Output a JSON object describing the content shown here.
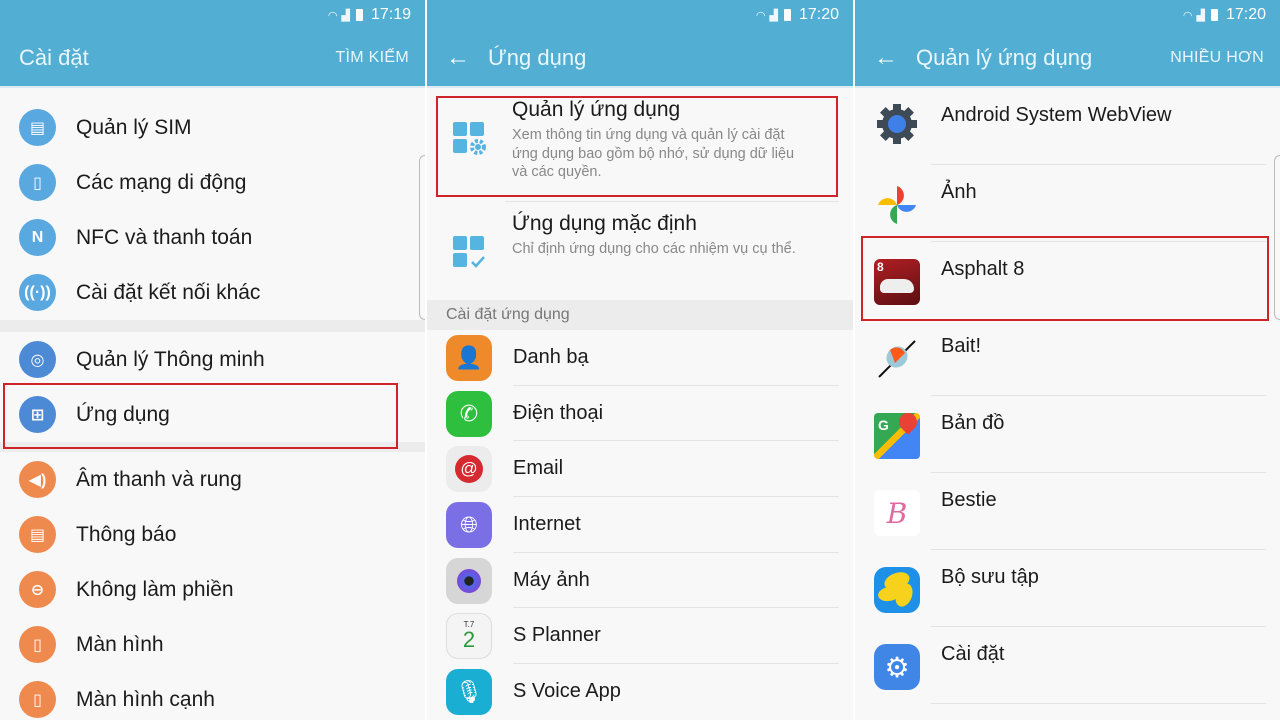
{
  "colors": {
    "appbar": "#52aed3",
    "highlight": "#d1232a"
  },
  "panel1": {
    "status": {
      "time": "17:19",
      "icons": [
        "wifi-icon",
        "signal-icon",
        "battery-icon"
      ]
    },
    "title": "Cài đặt",
    "action": "TÌM KIẾM",
    "group1": [
      {
        "label": "Quản lý SIM",
        "icon": "sim-card-icon"
      },
      {
        "label": "Các mạng di động",
        "icon": "mobile-network-icon"
      },
      {
        "label": "NFC và thanh toán",
        "icon": "nfc-icon"
      },
      {
        "label": "Cài đặt kết nối khác",
        "icon": "connection-icon"
      }
    ],
    "group2": [
      {
        "label": "Quản lý Thông minh",
        "icon": "smart-manager-icon"
      },
      {
        "label": "Ứng dụng",
        "icon": "apps-grid-icon",
        "highlighted": true
      }
    ],
    "group3": [
      {
        "label": "Âm thanh và rung",
        "icon": "speaker-icon"
      },
      {
        "label": "Thông báo",
        "icon": "notification-icon"
      },
      {
        "label": "Không làm phiền",
        "icon": "do-not-disturb-icon"
      },
      {
        "label": "Màn hình",
        "icon": "display-icon"
      },
      {
        "label": "Màn hình cạnh",
        "icon": "edge-screen-icon"
      }
    ]
  },
  "panel2": {
    "status": {
      "time": "17:20"
    },
    "title": "Ứng dụng",
    "top_items": [
      {
        "title": "Quản lý ứng dụng",
        "subtitle": "Xem thông tin ứng dụng và quản lý cài đặt ứng dụng bao gồm bộ nhớ, sử dụng dữ liệu và các quyền.",
        "highlighted": true
      },
      {
        "title": "Ứng dụng mặc định",
        "subtitle": "Chỉ định ứng dụng cho các nhiệm vụ cụ thể."
      }
    ],
    "section_header": "Cài đặt ứng dụng",
    "apps": [
      {
        "label": "Danh bạ",
        "icon": "contacts-icon"
      },
      {
        "label": "Điện thoại",
        "icon": "phone-icon"
      },
      {
        "label": "Email",
        "icon": "email-icon"
      },
      {
        "label": "Internet",
        "icon": "internet-icon"
      },
      {
        "label": "Máy ảnh",
        "icon": "camera-icon"
      },
      {
        "label": "S Planner",
        "icon": "calendar-icon",
        "icon_text_top": "T.7",
        "icon_text_num": "2"
      },
      {
        "label": "S Voice App",
        "icon": "microphone-icon"
      }
    ]
  },
  "panel3": {
    "status": {
      "time": "17:20"
    },
    "title": "Quản lý ứng dụng",
    "action": "NHIỀU HƠN",
    "apps": [
      {
        "label": "Android System WebView",
        "icon": "webview-gear-icon"
      },
      {
        "label": "Ảnh",
        "icon": "photos-pinwheel-icon"
      },
      {
        "label": "Asphalt 8",
        "icon": "asphalt-car-icon",
        "highlighted": true,
        "icon_badge": "8"
      },
      {
        "label": "Bait!",
        "icon": "fishing-float-icon"
      },
      {
        "label": "Bản đồ",
        "icon": "maps-icon",
        "icon_letter": "G"
      },
      {
        "label": "Bestie",
        "icon": "bestie-icon",
        "icon_letter": "B"
      },
      {
        "label": "Bộ sưu tập",
        "icon": "gallery-icon"
      },
      {
        "label": "Cài đặt",
        "icon": "settings-gear-icon"
      }
    ]
  }
}
